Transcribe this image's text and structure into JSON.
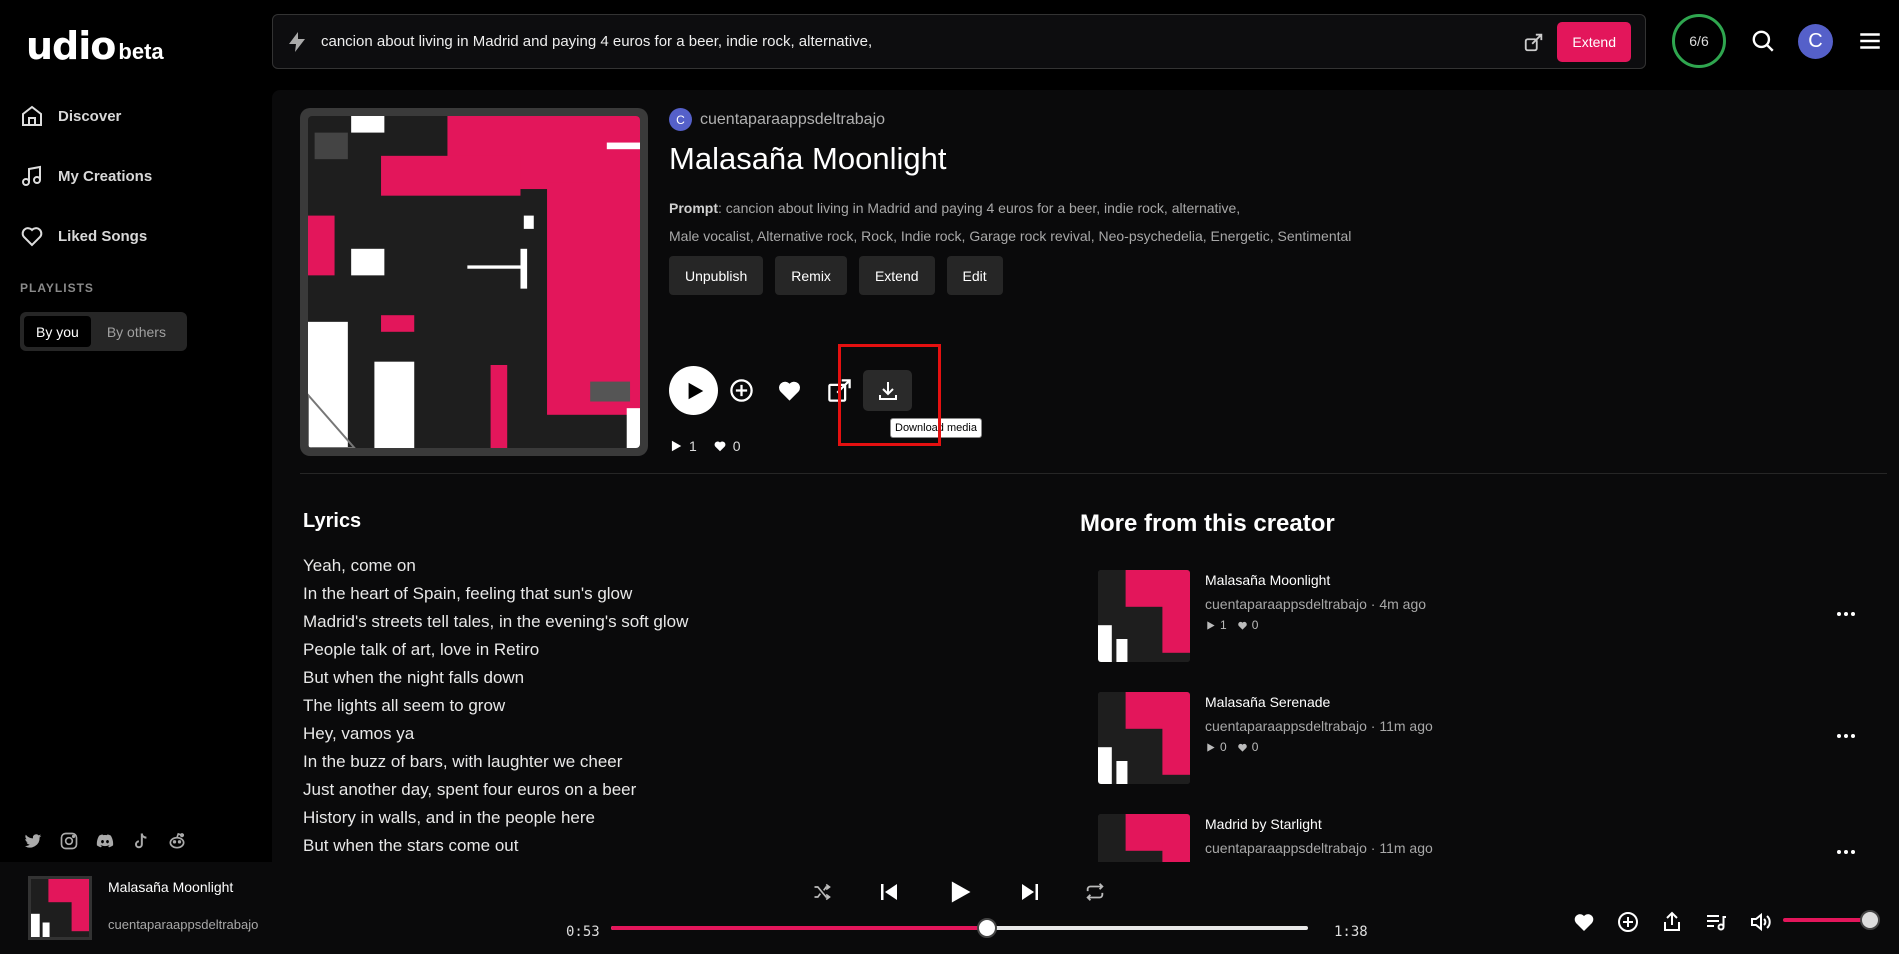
{
  "brand": {
    "name": "udio",
    "tag": "beta"
  },
  "sidebar": {
    "items": [
      {
        "label": "Discover",
        "icon": "home-icon"
      },
      {
        "label": "My Creations",
        "icon": "music-note-icon"
      },
      {
        "label": "Liked Songs",
        "icon": "heart-icon"
      }
    ],
    "playlists_label": "PLAYLISTS",
    "playlist_tabs": [
      {
        "label": "By you",
        "active": true
      },
      {
        "label": "By others",
        "active": false
      }
    ],
    "socials": [
      "twitter-icon",
      "instagram-icon",
      "discord-icon",
      "tiktok-icon",
      "reddit-icon"
    ]
  },
  "topbar": {
    "prompt": "cancion about living in Madrid and paying 4 euros for a beer, indie rock, alternative,",
    "extend_label": "Extend",
    "credits": "6/6",
    "avatar_letter": "C"
  },
  "song": {
    "creator_initial": "C",
    "creator": "cuentaparaappsdeltrabajo",
    "title": "Malasaña Moonlight",
    "prompt_label": "Prompt",
    "prompt": ": cancion about living in Madrid and paying 4 euros for a beer, indie rock, alternative,",
    "tags": "Male vocalist, Alternative rock, Rock, Indie rock, Garage rock revival, Neo-psychedelia, Energetic, Sentimental",
    "buttons": {
      "unpublish": "Unpublish",
      "remix": "Remix",
      "extend": "Extend",
      "edit": "Edit"
    },
    "tooltip": "Download media",
    "plays": "1",
    "likes": "0"
  },
  "lyrics": {
    "title": "Lyrics",
    "lines": [
      "Yeah, come on",
      "In the heart of Spain, feeling that sun's glow",
      "Madrid's streets tell tales, in the evening's soft glow",
      "People talk of art, love in Retiro",
      "But when the night falls down",
      "The lights all seem to grow",
      "Hey, vamos ya",
      "In the buzz of bars, with laughter we cheer",
      "Just another day, spent four euros on a beer",
      "History in walls, and in the people here",
      "But when the stars come out"
    ]
  },
  "more": {
    "title": "More from this creator",
    "items": [
      {
        "title": "Malasaña Moonlight",
        "creator": "cuentaparaappsdeltrabajo",
        "age": "· 4m ago",
        "plays": "1",
        "likes": "0"
      },
      {
        "title": "Malasaña Serenade",
        "creator": "cuentaparaappsdeltrabajo",
        "age": "· 11m ago",
        "plays": "0",
        "likes": "0"
      },
      {
        "title": "Madrid by Starlight",
        "creator": "cuentaparaappsdeltrabajo",
        "age": "· 11m ago",
        "plays": "",
        "likes": ""
      }
    ]
  },
  "player": {
    "title": "Malasaña Moonlight",
    "creator": "cuentaparaappsdeltrabajo",
    "elapsed": "0:53",
    "duration": "1:38",
    "progress_pct": 54,
    "volume_pct": 100
  },
  "colors": {
    "accent": "#e3165b",
    "avatar": "#5560c9",
    "credits_ring": "#2fa64f",
    "highlight": "#e51010"
  }
}
